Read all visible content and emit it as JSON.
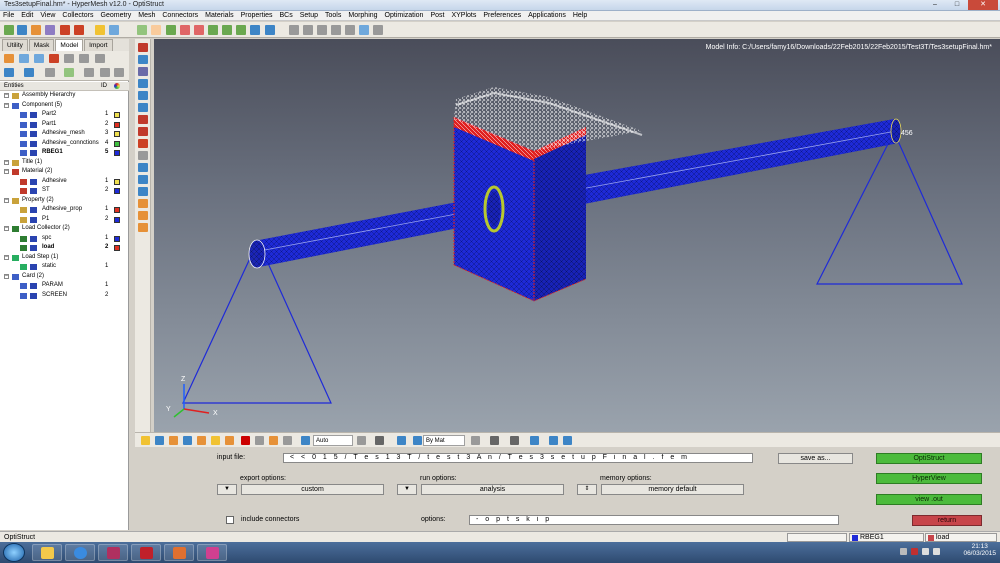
{
  "window": {
    "title": "Tes3setupFinal.hm* - HyperMesh v12.0 - OptiStruct",
    "buttons": [
      "–",
      "□",
      "✕"
    ]
  },
  "menu": [
    "File",
    "Edit",
    "View",
    "Collectors",
    "Geometry",
    "Mesh",
    "Connectors",
    "Materials",
    "Properties",
    "BCs",
    "Setup",
    "Tools",
    "Morphing",
    "Optimization",
    "Post",
    "XYPlots",
    "Preferences",
    "Applications",
    "Help"
  ],
  "panel_tabs": [
    "Utility",
    "Mask",
    "Model",
    "Import"
  ],
  "entities_header": {
    "label": "Entities",
    "id": "ID"
  },
  "tree": [
    {
      "label": "Assembly Hierarchy",
      "level": 0,
      "icon": "folder-icon"
    },
    {
      "label": "Component (5)",
      "level": 0,
      "icon": "component-icon"
    },
    {
      "label": "Part2",
      "level": 2,
      "icon": "component-icon",
      "id": "1",
      "color": "#f0e050"
    },
    {
      "label": "Part1",
      "level": 2,
      "icon": "component-icon",
      "id": "2",
      "color": "#e03020"
    },
    {
      "label": "Adhesive_mesh",
      "level": 2,
      "icon": "component-icon",
      "id": "3",
      "color": "#f0e050"
    },
    {
      "label": "Adhesive_connctions",
      "level": 2,
      "icon": "component-icon",
      "id": "4",
      "color": "#40c040"
    },
    {
      "label": "RBEG1",
      "level": 2,
      "icon": "component-icon",
      "id": "5",
      "color": "#1e2ad8",
      "bold": true
    },
    {
      "label": "Title (1)",
      "level": 0,
      "icon": "title-icon"
    },
    {
      "label": "Material (2)",
      "level": 0,
      "icon": "material-icon"
    },
    {
      "label": "Adhesive",
      "level": 2,
      "icon": "material-icon",
      "id": "1",
      "color": "#f0e050"
    },
    {
      "label": "ST",
      "level": 2,
      "icon": "material-icon",
      "id": "2",
      "color": "#1e2ad8"
    },
    {
      "label": "Property (2)",
      "level": 0,
      "icon": "property-icon"
    },
    {
      "label": "Adhesive_prop",
      "level": 2,
      "icon": "property-icon",
      "id": "1",
      "color": "#e03020"
    },
    {
      "label": "P1",
      "level": 2,
      "icon": "property-icon",
      "id": "2",
      "color": "#1e2ad8"
    },
    {
      "label": "Load Collector (2)",
      "level": 0,
      "icon": "loadcol-icon"
    },
    {
      "label": "spc",
      "level": 2,
      "icon": "loadcol-icon",
      "id": "1",
      "color": "#1e2ad8"
    },
    {
      "label": "load",
      "level": 2,
      "icon": "loadcol-icon",
      "id": "2",
      "color": "#e03020",
      "bold": true
    },
    {
      "label": "Load Step (1)",
      "level": 0,
      "icon": "loadstep-icon"
    },
    {
      "label": "static",
      "level": 2,
      "icon": "loadstep-icon",
      "id": "1"
    },
    {
      "label": "Card (2)",
      "level": 0,
      "icon": "card-icon"
    },
    {
      "label": "PARAM",
      "level": 2,
      "icon": "card-icon",
      "id": "1"
    },
    {
      "label": "SCREEN",
      "level": 2,
      "icon": "card-icon",
      "id": "2"
    }
  ],
  "viewport": {
    "model_info": "Model Info: C:/Users/famy16/Downloads/22Feb2015/22Feb2015/Test3T/Tes3setupFinal.hm*",
    "node_label": "456",
    "axes": {
      "x": "X",
      "y": "Y",
      "z": "Z"
    },
    "colors": {
      "mesh_blue": "#1e2ad8",
      "load_red": "#e02020",
      "bg_top": "#4a4d5a",
      "bg_bottom": "#9aa3ad"
    }
  },
  "vp_toolbar": {
    "auto_select": "Auto",
    "color_mode": "By Mat"
  },
  "bottom_panel": {
    "input_file_label": "input file:",
    "input_file_value": "< < 0 1 5 / T e s 1 3 T / t e s t 3 A n / T e s 3 s e t u p F i n a l . f e m",
    "save_as": "save as...",
    "export_options_label": "export options:",
    "export_options_value": "custom",
    "run_options_label": "run options:",
    "run_options_value": "analysis",
    "memory_options_label": "memory options:",
    "memory_options_value": "memory default",
    "include_connectors": "include connectors",
    "options_label": "options:",
    "options_value": "- o p t s k i p",
    "btn_optistruct": "OptiStruct",
    "btn_hyperview": "HyperView",
    "btn_view_out": "view .out",
    "btn_return": "return"
  },
  "statusbar": {
    "text": "OptiStruct",
    "component": "RBEG1",
    "component_color": "#1e2ad8",
    "loadcol": "load",
    "loadcol_color": "#c7454a"
  },
  "taskbar": {
    "time": "21:13",
    "date": "06/03/2015"
  }
}
